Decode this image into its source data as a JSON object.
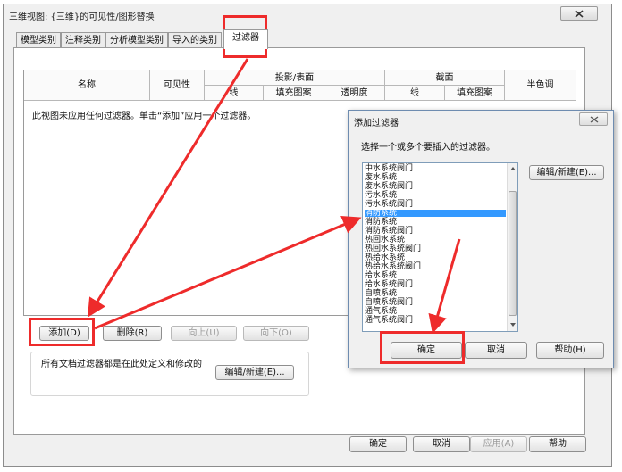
{
  "window": {
    "title": "三维视图: {三维}的可见性/图形替换",
    "tabs": [
      "模型类别",
      "注释类别",
      "分析模型类别",
      "导入的类别",
      "过滤器"
    ],
    "active_tab": "过滤器"
  },
  "grid": {
    "headers": {
      "name": "名称",
      "visibility": "可见性",
      "projection_surface": "投影/表面",
      "cut": "截面",
      "halftone": "半色调",
      "line": "线",
      "fill_pattern": "填充图案",
      "transparency": "透明度"
    },
    "empty_message": "此视图未应用任何过滤器。单击“添加”应用一个过滤器。"
  },
  "filter_buttons": {
    "add": "添加(D)",
    "delete": "删除(R)",
    "up": "向上(U)",
    "down": "向下(O)"
  },
  "doc_filters": {
    "text": "所有文档过滤器都是在此处定义和修改的",
    "edit_new": "编辑/新建(E)..."
  },
  "footer_buttons": {
    "ok": "确定",
    "cancel": "取消",
    "apply": "应用(A)",
    "help": "帮助"
  },
  "add_filter_dialog": {
    "title": "添加过滤器",
    "prompt": "选择一个或多个要插入的过滤器。",
    "items": [
      "中水系统阀门",
      "废水系统",
      "废水系统阀门",
      "污水系统",
      "污水系统阀门",
      "消防系统",
      "消防系统",
      "消防系统阀门",
      "热回水系统",
      "热回水系统阀门",
      "热给水系统",
      "热给水系统阀门",
      "给水系统",
      "给水系统阀门",
      "自喷系统",
      "自喷系统阀门",
      "通气系统",
      "通气系统阀门"
    ],
    "selected_index": 5,
    "edit_new": "编辑/新建(E)...",
    "ok": "确定",
    "cancel": "取消",
    "help": "帮助(H)"
  },
  "colors": {
    "annotation_red": "#ee2b2b",
    "selection_blue": "#3399ff"
  }
}
